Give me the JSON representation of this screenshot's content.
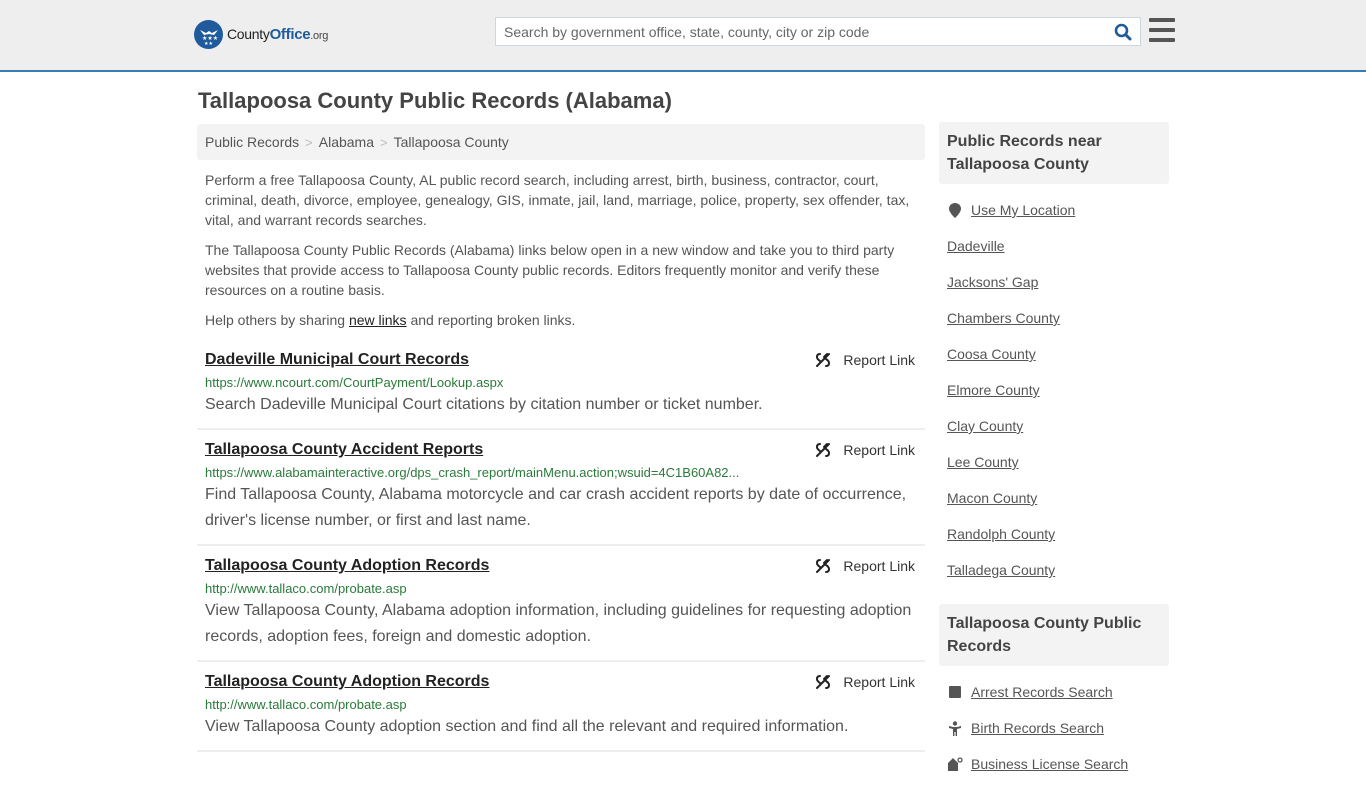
{
  "header": {
    "logo": {
      "brand_first": "County",
      "brand_second": "Office",
      "brand_tld": ".org"
    },
    "search": {
      "placeholder": "Search by government office, state, county, city or zip code",
      "value": ""
    },
    "colors": {
      "brand_blue": "#1e5a9c",
      "accent_line": "#3a7cb0"
    }
  },
  "page": {
    "title": "Tallapoosa County Public Records (Alabama)",
    "breadcrumb": [
      {
        "label": "Public Records"
      },
      {
        "label": "Alabama"
      },
      {
        "label": "Tallapoosa County"
      }
    ],
    "breadcrumb_separator": ">",
    "intro": {
      "p1": "Perform a free Tallapoosa County, AL public record search, including arrest, birth, business, contractor, court, criminal, death, divorce, employee, genealogy, GIS, inmate, jail, land, marriage, police, property, sex offender, tax, vital, and warrant records searches.",
      "p2": "The Tallapoosa County Public Records (Alabama) links below open in a new window and take you to third party websites that provide access to Tallapoosa County public records. Editors frequently monitor and verify these resources on a routine basis.",
      "p3_before": "Help others by sharing ",
      "p3_link": "new links",
      "p3_after": " and reporting broken links."
    }
  },
  "results": [
    {
      "title": "Dadeville Municipal Court Records",
      "url": "https://www.ncourt.com/CourtPayment/Lookup.aspx",
      "description": "Search Dadeville Municipal Court citations by citation number or ticket number.",
      "report_label": "Report Link"
    },
    {
      "title": "Tallapoosa County Accident Reports",
      "url": "https://www.alabamainteractive.org/dps_crash_report/mainMenu.action;wsuid=4C1B60A82...",
      "description": "Find Tallapoosa County, Alabama motorcycle and car crash accident reports by date of occurrence, driver's license number, or first and last name.",
      "report_label": "Report Link"
    },
    {
      "title": "Tallapoosa County Adoption Records",
      "url": "http://www.tallaco.com/probate.asp",
      "description": "View Tallapoosa County, Alabama adoption information, including guidelines for requesting adoption records, adoption fees, foreign and domestic adoption.",
      "report_label": "Report Link"
    },
    {
      "title": "Tallapoosa County Adoption Records",
      "url": "http://www.tallaco.com/probate.asp",
      "description": "View Tallapoosa County adoption section and find all the relevant and required information.",
      "report_label": "Report Link"
    }
  ],
  "sidebar": {
    "nearby": {
      "heading": "Public Records near Tallapoosa County",
      "use_location": "Use My Location",
      "items": [
        "Dadeville",
        "Jacksons' Gap",
        "Chambers County",
        "Coosa County",
        "Elmore County",
        "Clay County",
        "Lee County",
        "Macon County",
        "Randolph County",
        "Talladega County"
      ]
    },
    "county_records": {
      "heading": "Tallapoosa County Public Records",
      "items": [
        {
          "label": "Arrest Records Search",
          "icon": "square-icon"
        },
        {
          "label": "Birth Records Search",
          "icon": "child-icon"
        },
        {
          "label": "Business License Search",
          "icon": "business-icon"
        }
      ]
    }
  }
}
